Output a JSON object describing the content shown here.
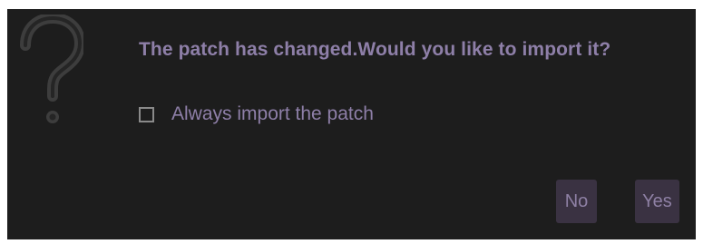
{
  "dialog": {
    "icon": "question-mark-icon",
    "message": "The patch has changed.Would you like to import it?",
    "checkbox_label": "Always import the patch",
    "checkbox_checked": false,
    "buttons": {
      "no": "No",
      "yes": "Yes"
    }
  },
  "colors": {
    "background": "#1d1d1d",
    "text": "#8e7fa8",
    "button": "#3a3242",
    "icon": "#3d3d3d"
  }
}
